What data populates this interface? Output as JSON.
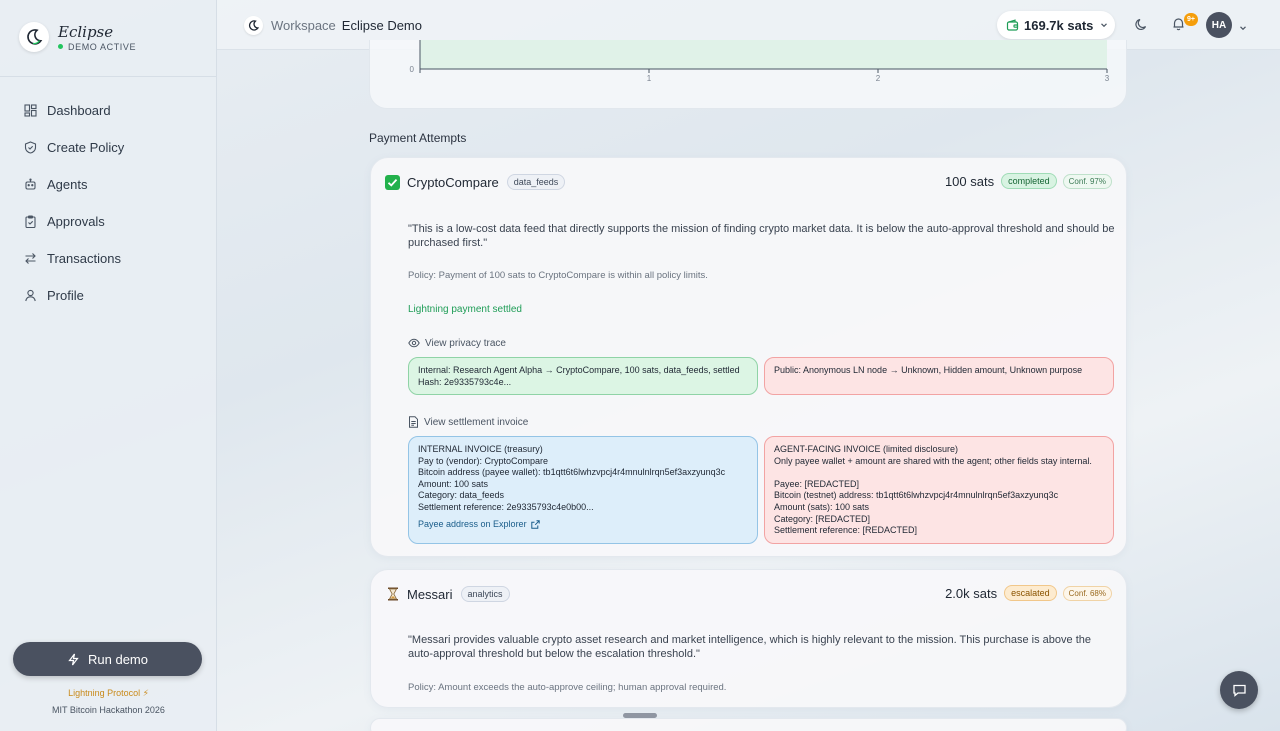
{
  "brand": {
    "name": "Eclipse",
    "status": "DEMO ACTIVE",
    "status_color": "#22c55e"
  },
  "sidebar": {
    "items": [
      {
        "label": "Dashboard",
        "icon": "dashboard-icon"
      },
      {
        "label": "Create Policy",
        "icon": "shield-icon"
      },
      {
        "label": "Agents",
        "icon": "robot-icon"
      },
      {
        "label": "Approvals",
        "icon": "clipboard-icon"
      },
      {
        "label": "Transactions",
        "icon": "transfer-icon"
      },
      {
        "label": "Profile",
        "icon": "user-icon"
      }
    ],
    "run_label": "Run demo",
    "footer_protocol": "Lightning Protocol ⚡",
    "footer_event": "MIT Bitcoin Hackathon 2026"
  },
  "header": {
    "workspace_label": "Workspace",
    "workspace_name": "Eclipse Demo",
    "balance": "169.7k sats",
    "notifications_badge": "9+",
    "avatar_initials": "HA"
  },
  "chart": {
    "y_ticks": [
      "0"
    ],
    "x_ticks": [
      "1",
      "2",
      "3"
    ]
  },
  "section_title": "Payment Attempts",
  "attempts": [
    {
      "vendor": "CryptoCompare",
      "category": "data_feeds",
      "amount": "100 sats",
      "status": "completed",
      "confidence": "Conf. 97%",
      "quote": "\"This is a low-cost data feed that directly supports the mission of finding crypto market data. It is below the auto-approval threshold and should be purchased first.\"",
      "policy": "Policy: Payment of 100 sats to CryptoCompare is within all policy limits.",
      "settled": "Lightning payment settled",
      "privacy_link": "View privacy trace",
      "trace_internal_1": "Internal: Research Agent Alpha → CryptoCompare, 100 sats, data_feeds, settled",
      "trace_internal_2": "Hash: 2e9335793c4e...",
      "trace_public": "Public: Anonymous LN node → Unknown, Hidden amount, Unknown purpose",
      "invoice_link": "View settlement invoice",
      "internal_invoice": {
        "title": "INTERNAL INVOICE (treasury)",
        "pay_to": "Pay to (vendor): CryptoCompare",
        "address": "Bitcoin address (payee wallet): tb1qtt6t6lwhzvpcj4r4mnulnlrqn5ef3axzyunq3c",
        "amount": "Amount: 100 sats",
        "category": "Category: data_feeds",
        "reference": "Settlement reference: 2e9335793c4e0b00...",
        "explorer": "Payee address on Explorer"
      },
      "agent_invoice": {
        "title": "AGENT-FACING INVOICE (limited disclosure)",
        "note": "Only payee wallet + amount are shared with the agent; other fields stay internal.",
        "payee": "Payee: [REDACTED]",
        "address": "Bitcoin (testnet) address: tb1qtt6t6lwhzvpcj4r4mnulnlrqn5ef3axzyunq3c",
        "amount": "Amount (sats): 100 sats",
        "category": "Category: [REDACTED]",
        "reference": "Settlement reference: [REDACTED]"
      }
    },
    {
      "vendor": "Messari",
      "category": "analytics",
      "amount": "2.0k sats",
      "status": "escalated",
      "confidence": "Conf. 68%",
      "quote": "\"Messari provides valuable crypto asset research and market intelligence, which is highly relevant to the mission. This purchase is above the auto-approval threshold but below the escalation threshold.\"",
      "policy": "Policy: Amount exceeds the auto-approve ceiling; human approval required."
    }
  ],
  "colors": {
    "accent": "#4a5160",
    "success": "#1f9d57",
    "warning": "#f59e0b"
  }
}
